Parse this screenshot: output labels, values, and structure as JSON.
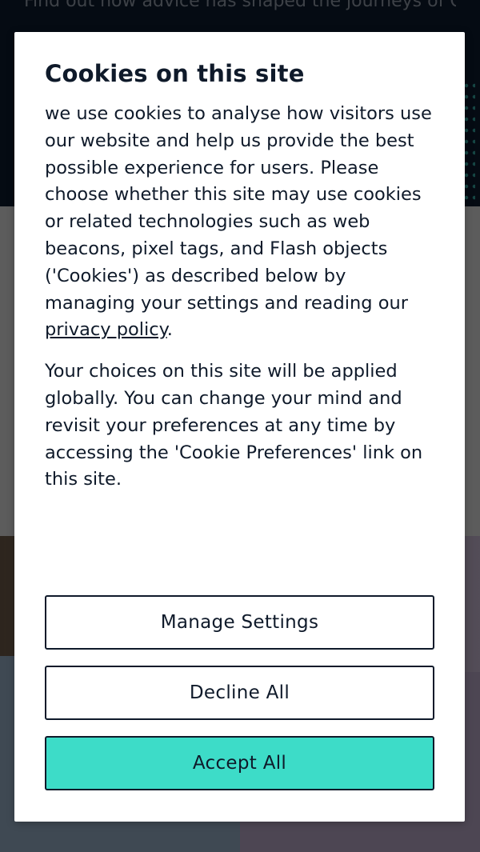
{
  "background": {
    "hero_text": "Find out how advice has shaped the journeys of Oti Mabuse, Ashley"
  },
  "cookie_modal": {
    "title": "Cookies on this site",
    "body_before_link": "we use cookies to analyse how visitors use our website and help us provide the best possible experience for users. Please choose whether this site may use cookies or related technologies such as web beacons, pixel tags, and Flash objects ('Cookies') as described below by managing your settings and reading our ",
    "privacy_link": "privacy policy",
    "body_after_link": ".",
    "body2": "Your choices on this site will be applied globally. You can change your mind and revisit your preferences at any time by accessing the 'Cookie Preferences' link on this site.",
    "buttons": {
      "manage": "Manage Settings",
      "decline": "Decline All",
      "accept": "Accept All"
    }
  },
  "colors": {
    "accent": "#3ddcc8",
    "text": "#0f1a2a",
    "hero_bg": "#0b1626"
  }
}
